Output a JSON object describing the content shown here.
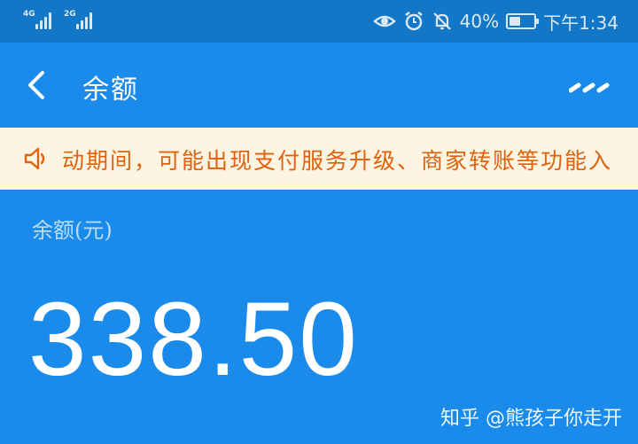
{
  "status_bar": {
    "signal_1": "4G",
    "signal_2": "2G",
    "battery": "40%",
    "time": "下午1:34",
    "icons": [
      "eye-icon",
      "alarm-icon",
      "bell-muted-icon",
      "battery-icon"
    ]
  },
  "nav": {
    "title": "余额",
    "back_icon": "chevron-left-icon",
    "more_icon": "more-icon"
  },
  "notice": {
    "icon": "speaker-icon",
    "text": "动期间，可能出现支付服务升级、商家转账等功能入"
  },
  "balance": {
    "label": "余额(元)",
    "amount": "338.50"
  },
  "watermark": "知乎 @熊孩子你走开",
  "colors": {
    "status_bar": "#1277c6",
    "primary": "#1a8bea",
    "notice_bg": "#fdf4e1",
    "notice_text": "#e0620e"
  }
}
